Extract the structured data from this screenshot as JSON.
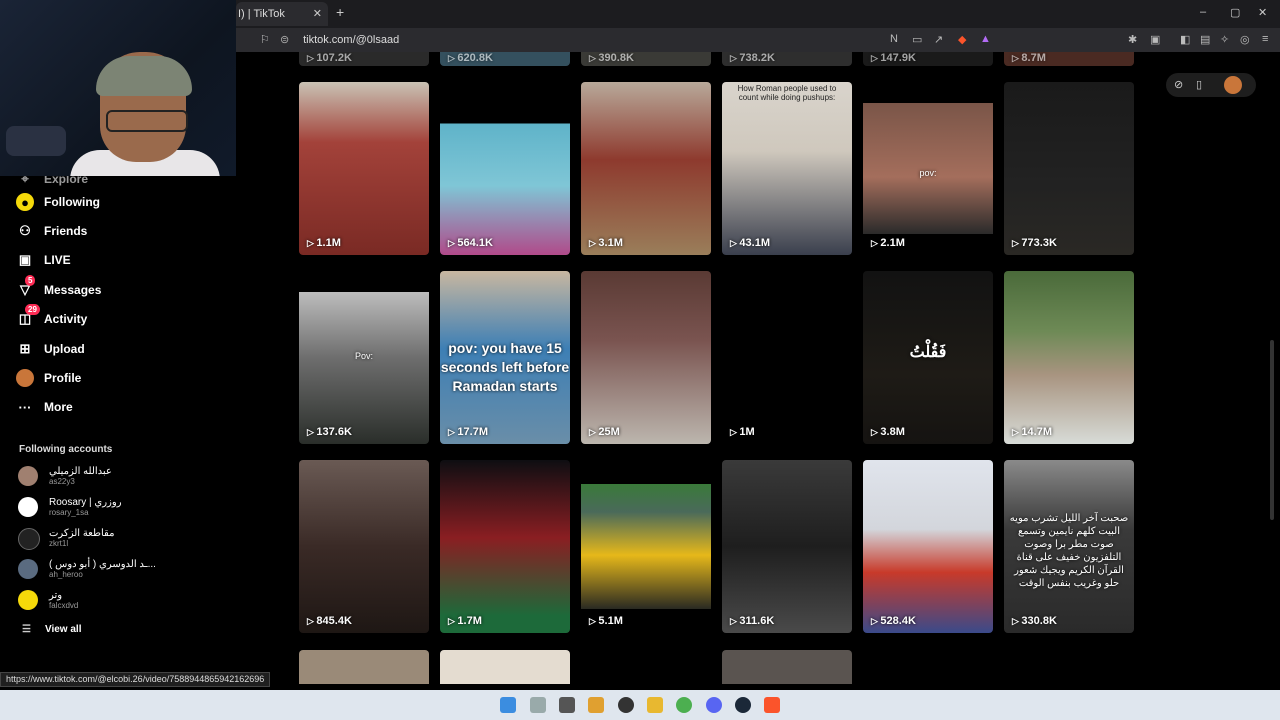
{
  "browser": {
    "tab_title": "I) | TikTok",
    "url": "tiktok.com/@0lsaad",
    "new_tab": "+",
    "close": "✕",
    "minimize": "–",
    "maximize": "▢"
  },
  "sidebar": {
    "partial_item": "Explore",
    "items": [
      {
        "label": "Following",
        "icon": "following-icon"
      },
      {
        "label": "Friends",
        "icon": "friends-icon"
      },
      {
        "label": "LIVE",
        "icon": "live-icon"
      },
      {
        "label": "Messages",
        "icon": "messages-icon",
        "badge": "5"
      },
      {
        "label": "Activity",
        "icon": "activity-icon",
        "badge": "29"
      },
      {
        "label": "Upload",
        "icon": "upload-icon"
      },
      {
        "label": "Profile",
        "icon": "profile-icon"
      },
      {
        "label": "More",
        "icon": "more-icon"
      }
    ],
    "following_title": "Following accounts",
    "accounts": [
      {
        "name": "عبدالله الزميلي",
        "handle": "as22y3"
      },
      {
        "name": "Roosary | روزري",
        "handle": "rosary_1sa"
      },
      {
        "name": "مقاطعة الزكرت",
        "handle": "zkrt1l"
      },
      {
        "name": "ـد الدوسري ( أبو دوس )...",
        "handle": "ah_heroo"
      },
      {
        "name": "وتر",
        "handle": "falcxdvd"
      }
    ],
    "view_all": "View all"
  },
  "grid": {
    "top_partial_views": [
      "107.2K",
      "620.8K",
      "390.8K",
      "738.2K",
      "147.9K",
      "8.7M"
    ],
    "rows": [
      [
        {
          "views": "1.1M",
          "overlay": ""
        },
        {
          "views": "564.1K",
          "overlay": ""
        },
        {
          "views": "3.1M",
          "overlay": ""
        },
        {
          "views": "43.1M",
          "overlay": "How Roman people used to count while doing pushups:"
        },
        {
          "views": "2.1M",
          "overlay": "pov:"
        },
        {
          "views": "773.3K",
          "overlay": ""
        }
      ],
      [
        {
          "views": "137.6K",
          "overlay": "Pov:"
        },
        {
          "views": "17.7M",
          "overlay": "pov: you have 15 seconds left before Ramadan starts"
        },
        {
          "views": "25M",
          "overlay": ""
        },
        {
          "views": "1M",
          "overlay": ""
        },
        {
          "views": "3.8M",
          "overlay": "فَقُلْتُ"
        },
        {
          "views": "14.7M",
          "overlay": ""
        }
      ],
      [
        {
          "views": "845.4K",
          "overlay": ""
        },
        {
          "views": "1.7M",
          "overlay": ""
        },
        {
          "views": "5.1M",
          "overlay": ""
        },
        {
          "views": "311.6K",
          "overlay": ""
        },
        {
          "views": "528.4K",
          "overlay": ""
        },
        {
          "views": "330.8K",
          "overlay": "صحبت آخر الليل تشرب مويه البيت كلهم نايمين وتسمع صوت مطر برا وصوت التلفزيون خفيف على قناة القرآن الكريم ويجيك شعور حلو وغريب بنفس الوقت"
        }
      ]
    ]
  },
  "status_url": "https://www.tiktok.com/@elcobi.26/video/7588944865942162696",
  "colors": {
    "accent": "#fe2c55",
    "background": "#000000"
  }
}
